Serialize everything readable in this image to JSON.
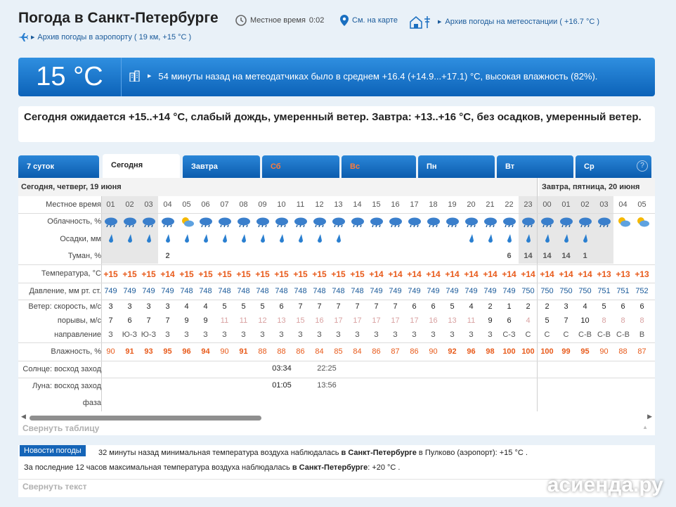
{
  "header": {
    "title": "Погода в Санкт-Петербурге",
    "local_time_label": "Местное время",
    "local_time": "0:02",
    "map_link": "См. на карте",
    "station_link": "Архив погоды на метеостанции ( +16.7 °С )",
    "airport_link": "Архив погоды в аэропорту ( 19 км, +15 °С )"
  },
  "now": {
    "temp": "15 °С",
    "message": "54 минуты назад на метеодатчиках было в среднем +16.4 (+14.9...+17.1) °С, высокая влажность (82%)."
  },
  "summary": "Сегодня ожидается +15..+14 °С, слабый дождь, умеренный ветер. Завтра: +13..+16 °С, без осадков, умеренный ветер.",
  "tabs": [
    {
      "label": "7 суток",
      "weekend": false,
      "selected": false
    },
    {
      "label": "Сегодня",
      "weekend": false,
      "selected": true
    },
    {
      "label": "Завтра",
      "weekend": false,
      "selected": false
    },
    {
      "label": "Сб",
      "weekend": true,
      "selected": false
    },
    {
      "label": "Вс",
      "weekend": true,
      "selected": false
    },
    {
      "label": "Пн",
      "weekend": false,
      "selected": false
    },
    {
      "label": "Вт",
      "weekend": false,
      "selected": false
    },
    {
      "label": "Ср",
      "weekend": false,
      "selected": false
    }
  ],
  "help": "?",
  "days": {
    "today": "Сегодня, четверг, 19 июня",
    "tomorrow": "Завтра, пятница, 20 июня"
  },
  "rows": {
    "time": "Местное время",
    "cloud": "Облачность, %",
    "precip": "Осадки, мм",
    "fog": "Туман, %",
    "temp": "Температура, °С",
    "pressure": "Давление, мм рт. ст.",
    "wind_speed": "Ветер: скорость, м/с",
    "gusts": "порывы, м/с",
    "direction": "направление",
    "humidity": "Влажность, %",
    "sun": "Солнце: восход заход",
    "moon": "Луна: восход заход",
    "phase": "фаза"
  },
  "hours": [
    "01",
    "02",
    "03",
    "04",
    "05",
    "06",
    "07",
    "08",
    "09",
    "10",
    "11",
    "12",
    "13",
    "14",
    "15",
    "16",
    "17",
    "18",
    "19",
    "20",
    "21",
    "22",
    "23",
    "00",
    "01",
    "02",
    "03",
    "04",
    "05"
  ],
  "night_hours": [
    0,
    1,
    2,
    22,
    23,
    24,
    25,
    26
  ],
  "cloud_icons": [
    "rain",
    "rain",
    "rain",
    "rain",
    "sun",
    "rain",
    "rain",
    "rain",
    "rain",
    "rain",
    "rain",
    "rain",
    "rain",
    "rain",
    "rain",
    "rain",
    "rain",
    "rain",
    "rain",
    "rain",
    "rain",
    "rain",
    "rain",
    "rain",
    "rain",
    "rain",
    "rain",
    "sun",
    "sun"
  ],
  "precip": [
    1,
    1,
    1,
    1,
    1,
    1,
    1,
    1,
    1,
    1,
    1,
    1,
    1,
    0,
    0,
    0,
    0,
    0,
    0,
    1,
    1,
    1,
    1,
    1,
    1,
    1,
    0,
    0,
    0
  ],
  "fog": [
    "",
    "",
    "",
    "2",
    "",
    "",
    "",
    "",
    "",
    "",
    "",
    "",
    "",
    "",
    "",
    "",
    "",
    "",
    "",
    "",
    "",
    "6",
    "14",
    "14",
    "14",
    "1",
    "",
    "",
    ""
  ],
  "temps": [
    "+15",
    "+15",
    "+15",
    "+14",
    "+15",
    "+15",
    "+15",
    "+15",
    "+15",
    "+15",
    "+15",
    "+15",
    "+15",
    "+15",
    "+14",
    "+14",
    "+14",
    "+14",
    "+14",
    "+14",
    "+14",
    "+14",
    "+14",
    "+14",
    "+14",
    "+14",
    "+13",
    "+13",
    "+13"
  ],
  "pressure": [
    "749",
    "749",
    "749",
    "749",
    "748",
    "748",
    "748",
    "748",
    "748",
    "748",
    "748",
    "748",
    "748",
    "748",
    "749",
    "749",
    "749",
    "749",
    "749",
    "749",
    "749",
    "749",
    "750",
    "750",
    "750",
    "750",
    "751",
    "751",
    "752"
  ],
  "wind": [
    "3",
    "3",
    "3",
    "3",
    "4",
    "4",
    "5",
    "5",
    "5",
    "6",
    "7",
    "7",
    "7",
    "7",
    "7",
    "7",
    "6",
    "6",
    "5",
    "4",
    "2",
    "1",
    "2",
    "2",
    "3",
    "4",
    "5",
    "6",
    "6"
  ],
  "gusts": [
    "7",
    "6",
    "7",
    "7",
    "9",
    "9",
    "11",
    "11",
    "12",
    "13",
    "15",
    "16",
    "17",
    "17",
    "17",
    "17",
    "17",
    "16",
    "13",
    "11",
    "9",
    "6",
    "4",
    "5",
    "7",
    "10",
    "8",
    "8",
    "8"
  ],
  "gusts_dim": [
    false,
    false,
    false,
    false,
    false,
    false,
    true,
    true,
    true,
    true,
    true,
    true,
    true,
    true,
    true,
    true,
    true,
    true,
    true,
    true,
    false,
    false,
    true,
    false,
    false,
    false,
    true,
    true,
    true
  ],
  "dir": [
    "З",
    "Ю-З",
    "Ю-З",
    "З",
    "З",
    "З",
    "З",
    "З",
    "З",
    "З",
    "З",
    "З",
    "З",
    "З",
    "З",
    "З",
    "З",
    "З",
    "З",
    "З",
    "З",
    "С-З",
    "С",
    "С",
    "С",
    "С-В",
    "С-В",
    "С-В",
    "В"
  ],
  "humidity": [
    "90",
    "91",
    "93",
    "95",
    "96",
    "94",
    "90",
    "91",
    "88",
    "88",
    "86",
    "84",
    "85",
    "84",
    "86",
    "87",
    "86",
    "90",
    "92",
    "96",
    "98",
    "100",
    "100",
    "100",
    "99",
    "95",
    "90",
    "88",
    "87"
  ],
  "humidity_bold": [
    false,
    true,
    true,
    true,
    true,
    true,
    false,
    true,
    false,
    false,
    false,
    false,
    false,
    false,
    false,
    false,
    false,
    false,
    true,
    true,
    true,
    true,
    true,
    true,
    true,
    true,
    false,
    false,
    false
  ],
  "sun": {
    "rise": "03:34",
    "set": "22:25"
  },
  "moon": {
    "rise": "01:05",
    "set": "13:56"
  },
  "collapse_table": "Свернуть таблицу",
  "news": {
    "badge": "Новости погоды",
    "l1_pre": "32 минуты назад минимальная температура воздуха наблюдалась ",
    "l1_city": "в Санкт-Петербурге",
    "l1_post": " в Пулково (аэропорт): +15 °С .",
    "l2_pre": "За последние 12 часов максимальная температура воздуха наблюдалась ",
    "l2_city": "в Санкт-Петербурге",
    "l2_post": ": +20 °С .",
    "collapse": "Свернуть текст"
  },
  "watermark": "асиенда.ру",
  "colors": {
    "accent": "#0c62b8",
    "temp": "#e85a1a",
    "link": "#1a5a9a"
  }
}
